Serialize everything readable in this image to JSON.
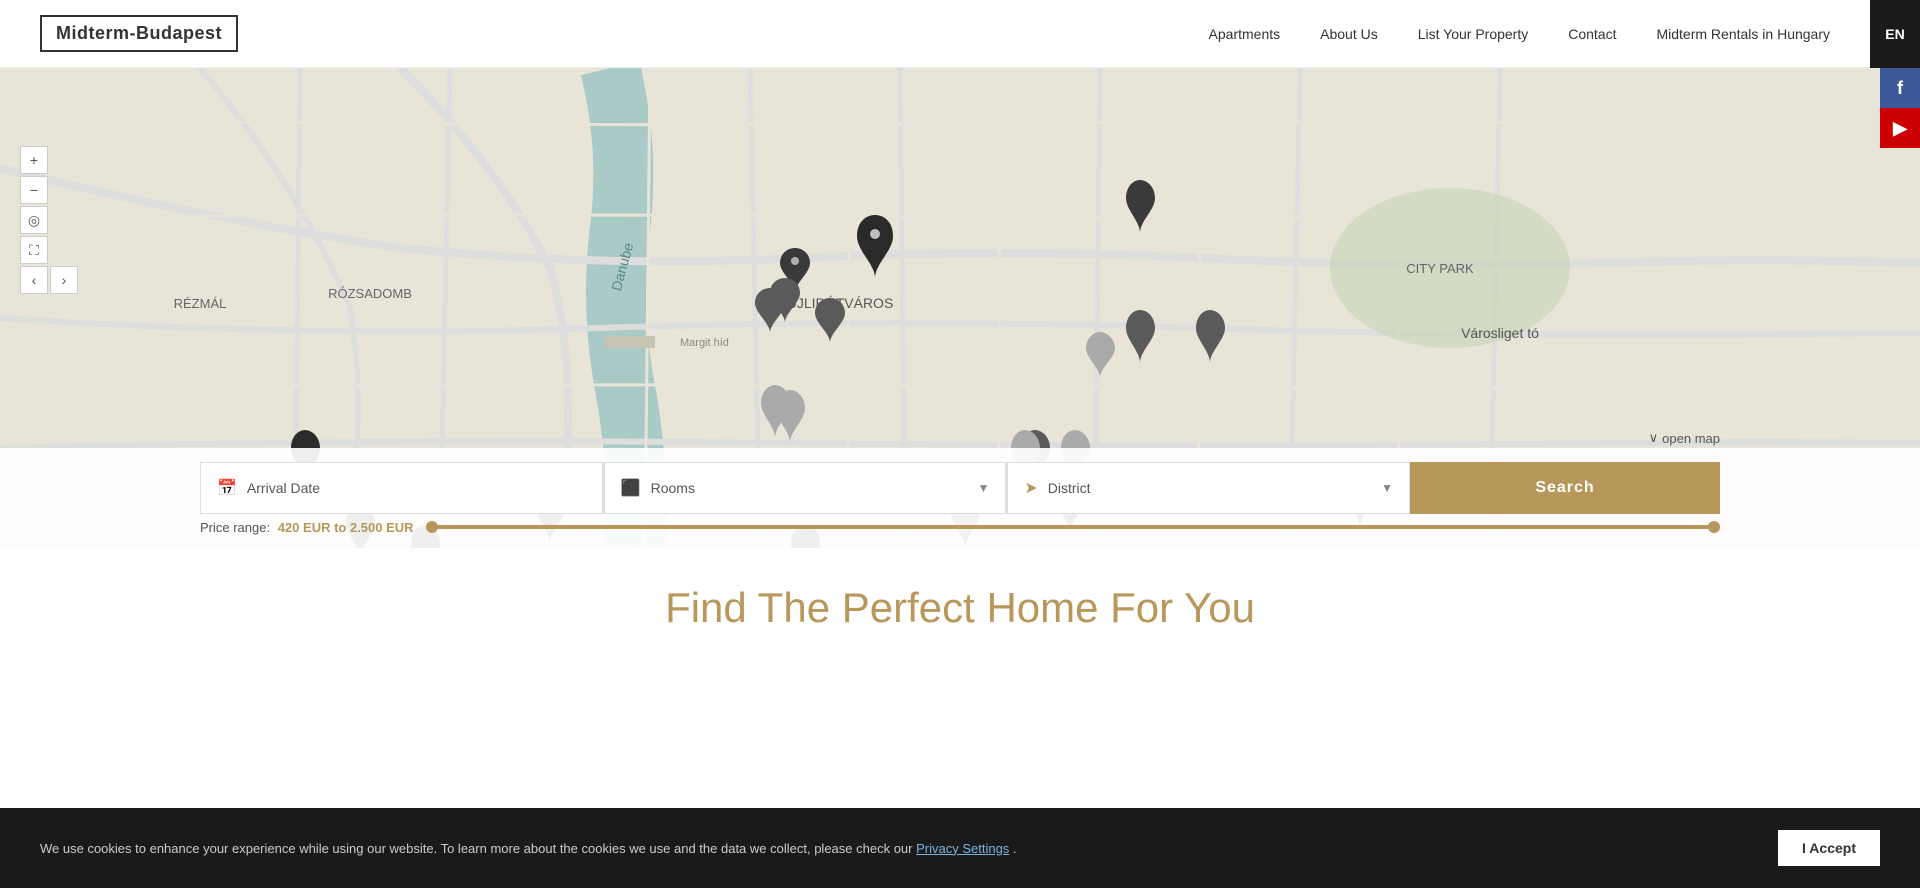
{
  "header": {
    "logo": "Midterm-Budapest",
    "nav": [
      {
        "id": "apartments",
        "label": "Apartments"
      },
      {
        "id": "about",
        "label": "About Us"
      },
      {
        "id": "list-property",
        "label": "List Your Property"
      },
      {
        "id": "contact",
        "label": "Contact"
      },
      {
        "id": "midterm-hungary",
        "label": "Midterm Rentals in Hungary"
      }
    ],
    "lang": "EN"
  },
  "map": {
    "controls": {
      "zoom_in": "+",
      "zoom_out": "−",
      "locate": "⊕",
      "fullscreen": "⛶",
      "prev": "‹",
      "next": "›"
    },
    "open_map_label": "open map"
  },
  "search": {
    "arrival_placeholder": "Arrival Date",
    "rooms_placeholder": "Rooms",
    "district_placeholder": "District",
    "search_label": "Search",
    "price_label": "Price range:",
    "price_range": "420 EUR to 2.500 EUR"
  },
  "social": [
    {
      "id": "facebook",
      "icon": "f",
      "label": "Facebook"
    },
    {
      "id": "youtube",
      "icon": "▶",
      "label": "YouTube"
    }
  ],
  "find_section": {
    "title": "Find The Perfect Home For You"
  },
  "cookie": {
    "text": "We use cookies to enhance your experience while using our website. To learn more about the cookies we use and the data we collect, please check our ",
    "link_text": "Privacy Settings",
    "suffix": ".",
    "accept_label": "I Accept"
  }
}
